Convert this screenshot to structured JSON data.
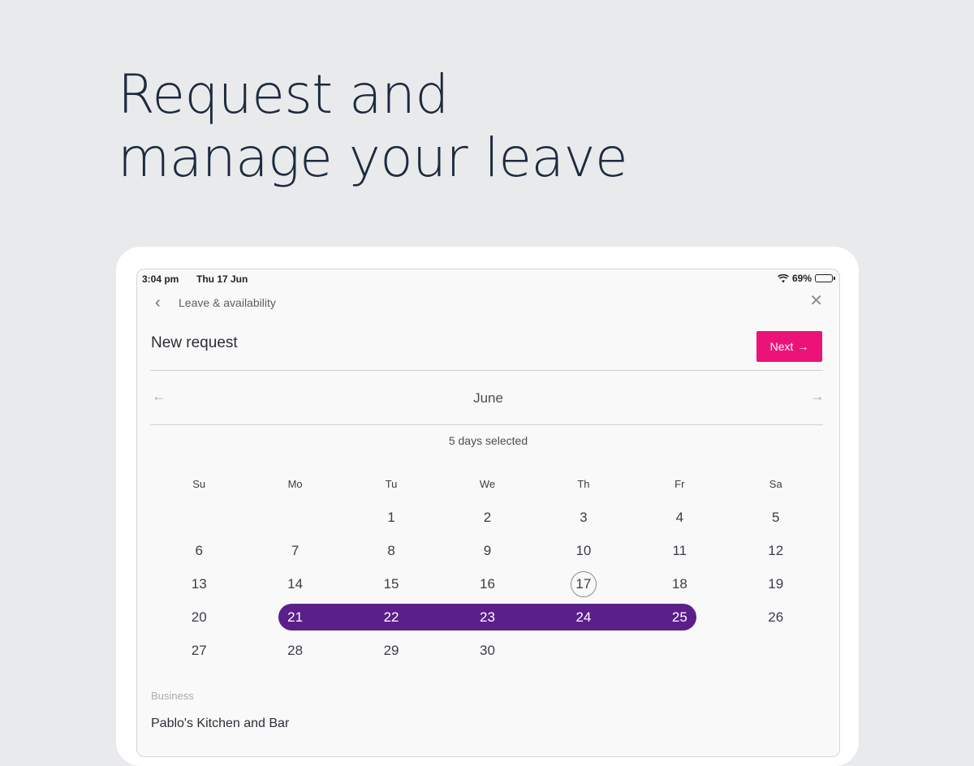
{
  "headline": {
    "line1": "Request and",
    "line2": "manage your leave"
  },
  "status_bar": {
    "time": "3:04 pm",
    "date": "Thu 17 Jun",
    "battery": "69%",
    "battery_level": 0.69
  },
  "nav": {
    "back_icon": "chevron-left-icon",
    "title": "Leave & availability",
    "close_icon": "close-icon"
  },
  "request": {
    "title": "New request",
    "next_label": "Next"
  },
  "calendar": {
    "month": "June",
    "selected_count": "5 days selected",
    "weekdays": [
      "Su",
      "Mo",
      "Tu",
      "We",
      "Th",
      "Fr",
      "Sa"
    ],
    "weeks": [
      [
        "",
        "",
        "1",
        "2",
        "3",
        "4",
        "5"
      ],
      [
        "6",
        "7",
        "8",
        "9",
        "10",
        "11",
        "12"
      ],
      [
        "13",
        "14",
        "15",
        "16",
        "17",
        "18",
        "19"
      ],
      [
        "20",
        "21",
        "22",
        "23",
        "24",
        "25",
        "26"
      ],
      [
        "27",
        "28",
        "29",
        "30",
        "",
        "",
        ""
      ]
    ],
    "today": "17",
    "selected_days": [
      "21",
      "22",
      "23",
      "24",
      "25"
    ],
    "selection_color": "#5b1f8a"
  },
  "business": {
    "label": "Business",
    "value": "Pablo's Kitchen and Bar"
  },
  "colors": {
    "accent": "#ec1378",
    "background": "#e9eaec",
    "headline": "#1d2b3f"
  }
}
